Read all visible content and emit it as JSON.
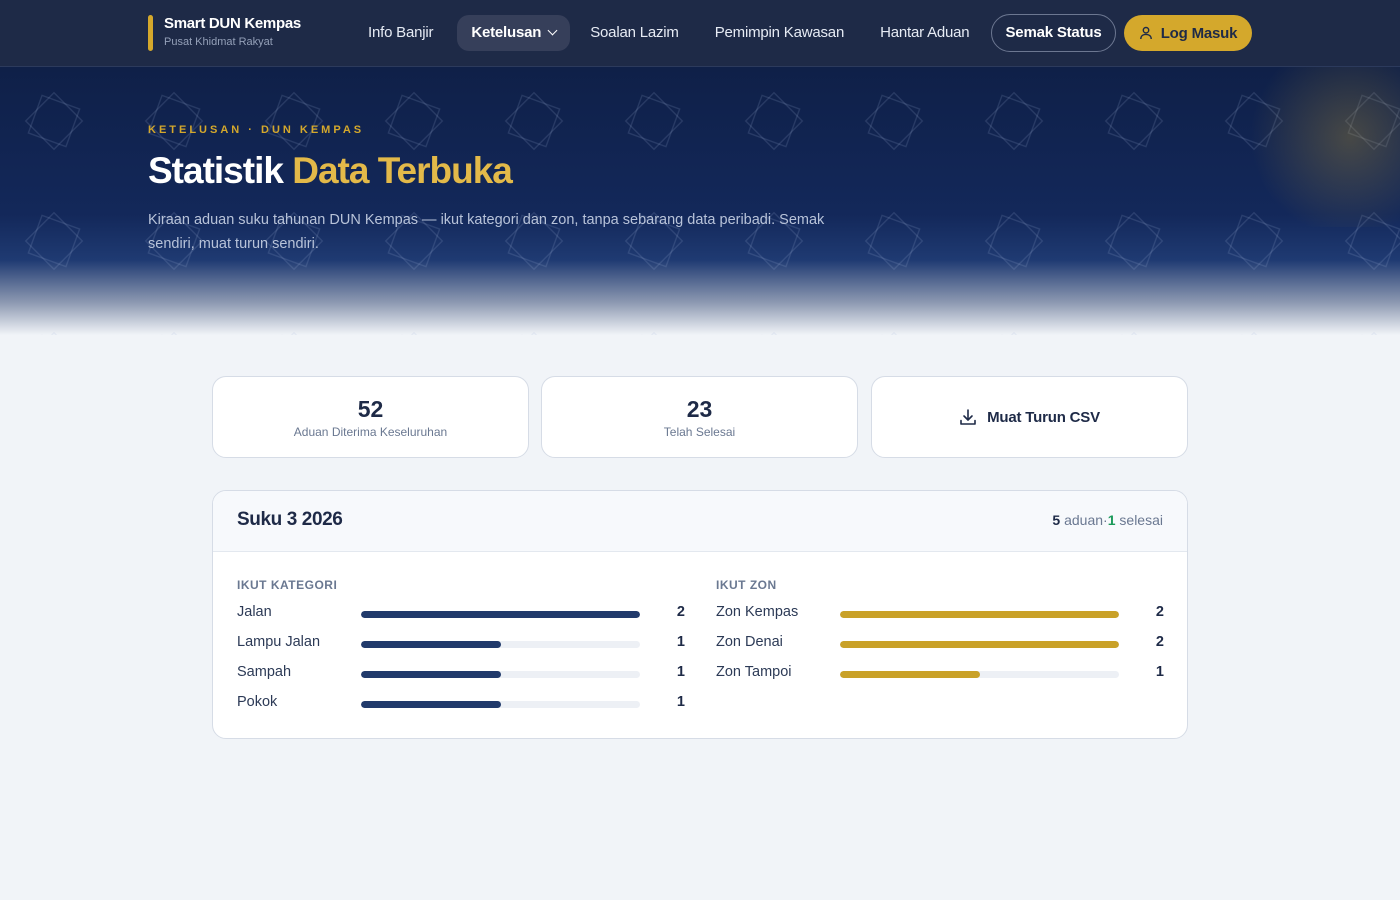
{
  "brand": {
    "name": "Smart DUN Kempas",
    "subtitle": "Pusat Khidmat Rakyat"
  },
  "nav": {
    "links": [
      {
        "label": "Info Banjir",
        "active": false
      },
      {
        "label": "Ketelusan",
        "active": true,
        "dropdown": true
      },
      {
        "label": "Soalan Lazim",
        "active": false
      },
      {
        "label": "Pemimpin Kawasan",
        "active": false
      },
      {
        "label": "Hantar Aduan",
        "active": false
      }
    ],
    "status_button": "Semak Status",
    "login_button": "Log Masuk"
  },
  "hero": {
    "eyebrow": "KETELUSAN · DUN KEMPAS",
    "title_main": "Statistik",
    "title_accent": "Data Terbuka",
    "description": "Kiraan aduan suku tahunan DUN Kempas — ikut kategori dan zon, tanpa sebarang data peribadi. Semak sendiri, muat turun sendiri."
  },
  "stats": {
    "total": {
      "value": "52",
      "label": "Aduan Diterima Keseluruhan"
    },
    "completed": {
      "value": "23",
      "label": "Telah Selesai"
    },
    "csv_label": "Muat Turun CSV"
  },
  "quarter": {
    "title": "Suku 3 2026",
    "complaints": "5",
    "complaints_word": "aduan",
    "separator": "·",
    "resolved": "1",
    "resolved_word": "selesai",
    "category_heading": "IKUT KATEGORI",
    "zone_heading": "IKUT ZON",
    "categories": [
      {
        "label": "Jalan",
        "count": 2,
        "share": 1.0
      },
      {
        "label": "Lampu Jalan",
        "count": 1,
        "share": 0.5
      },
      {
        "label": "Sampah",
        "count": 1,
        "share": 0.5
      },
      {
        "label": "Pokok",
        "count": 1,
        "share": 0.5
      }
    ],
    "zones": [
      {
        "label": "Zon Kempas",
        "count": 2,
        "share": 1.0
      },
      {
        "label": "Zon Denai",
        "count": 2,
        "share": 1.0
      },
      {
        "label": "Zon Tampoi",
        "count": 1,
        "share": 0.5
      }
    ]
  },
  "colors": {
    "navy": "#1e2a47",
    "gold": "#d4a82c",
    "green": "#1c9a5a",
    "category_bar": "#213a6b",
    "zone_bar": "#c9a128"
  },
  "icons": {
    "login": "user-icon",
    "csv": "download-icon",
    "dropdown": "chevron-down-icon"
  }
}
